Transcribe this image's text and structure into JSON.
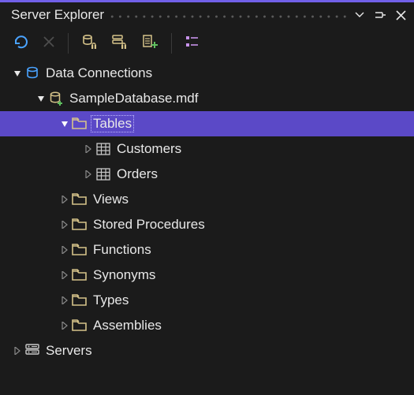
{
  "panel": {
    "title": "Server Explorer"
  },
  "tree": {
    "data_connections": {
      "label": "Data Connections",
      "db": {
        "label": "SampleDatabase.mdf",
        "folders": {
          "tables": {
            "label": "Tables",
            "items": [
              {
                "label": "Customers"
              },
              {
                "label": "Orders"
              }
            ]
          },
          "views": {
            "label": "Views"
          },
          "stored_procedures": {
            "label": "Stored Procedures"
          },
          "functions": {
            "label": "Functions"
          },
          "synonyms": {
            "label": "Synonyms"
          },
          "types": {
            "label": "Types"
          },
          "assemblies": {
            "label": "Assemblies"
          }
        }
      }
    },
    "servers": {
      "label": "Servers"
    }
  }
}
